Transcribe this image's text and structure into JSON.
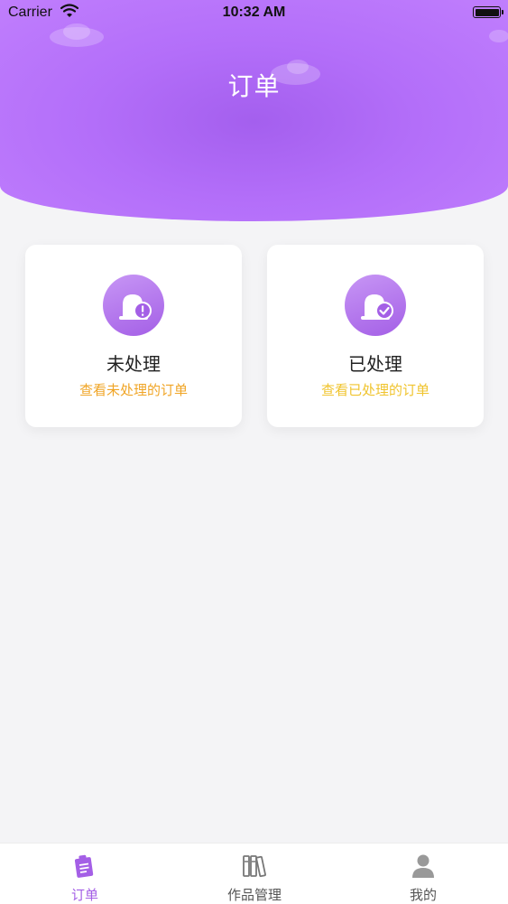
{
  "status_bar": {
    "carrier": "Carrier",
    "time": "10:32 AM"
  },
  "header": {
    "title": "订单"
  },
  "cards": [
    {
      "label": "未处理",
      "subtitle": "查看未处理的订单",
      "icon": "bell-alert-icon",
      "subtitle_color": "#f0a526"
    },
    {
      "label": "已处理",
      "subtitle": "查看已处理的订单",
      "icon": "bell-check-icon",
      "subtitle_color": "#f0c42e"
    }
  ],
  "tab_bar": {
    "items": [
      {
        "label": "订单",
        "icon": "order-clipboard-icon",
        "active": true
      },
      {
        "label": "作品管理",
        "icon": "books-icon",
        "active": false
      },
      {
        "label": "我的",
        "icon": "user-icon",
        "active": false
      }
    ]
  },
  "colors": {
    "accent": "#a45fe6",
    "header_gradient_light": "#c07efd",
    "header_gradient_dark": "#a45fee",
    "background": "#f4f4f6"
  }
}
